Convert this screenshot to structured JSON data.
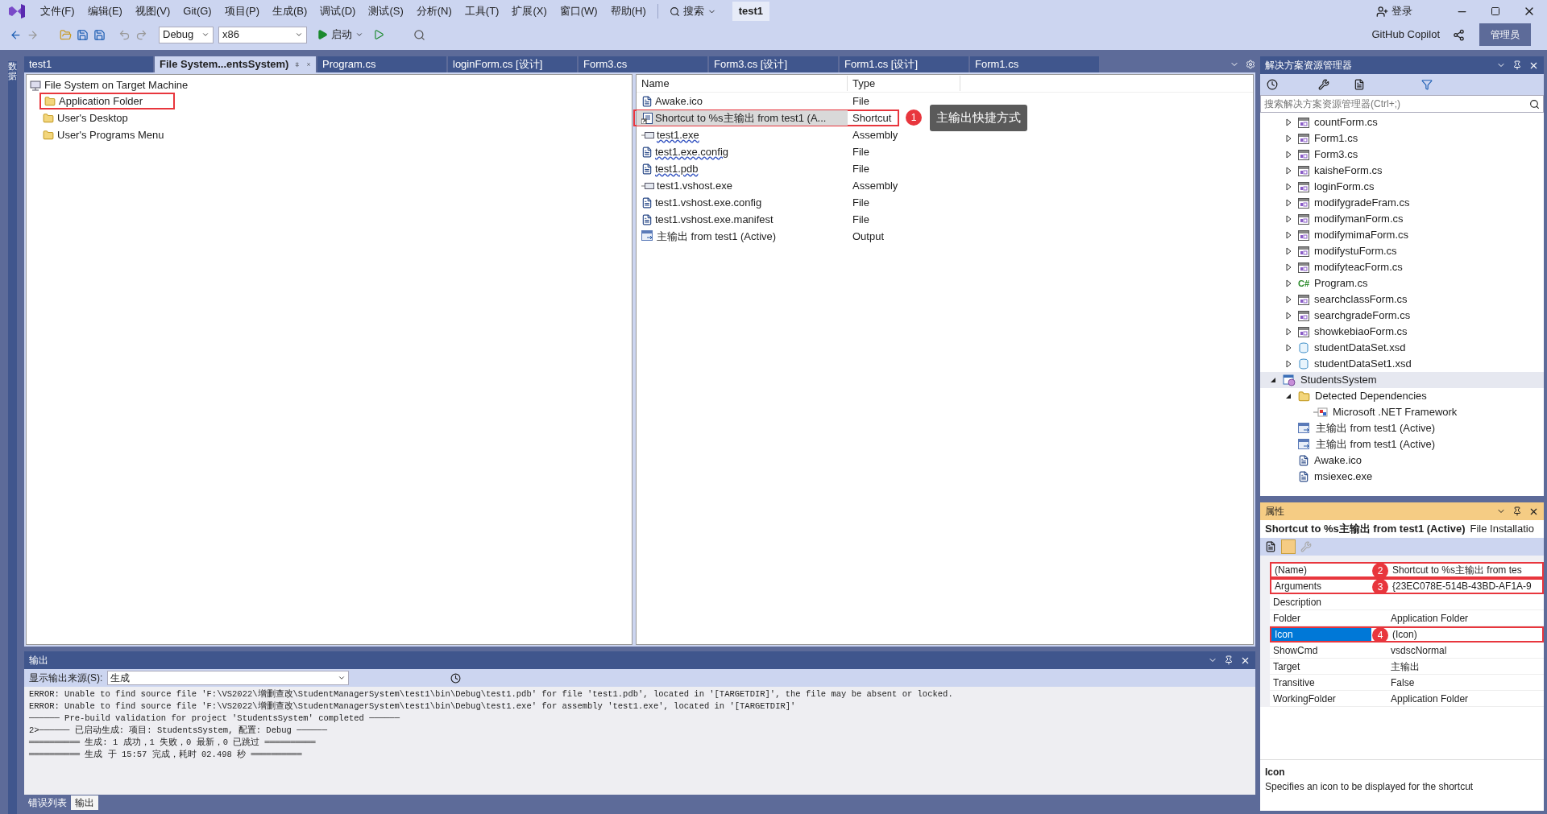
{
  "menu": [
    "文件(F)",
    "编辑(E)",
    "视图(V)",
    "Git(G)",
    "项目(P)",
    "生成(B)",
    "调试(D)",
    "测试(S)",
    "分析(N)",
    "工具(T)",
    "扩展(X)",
    "窗口(W)",
    "帮助(H)"
  ],
  "search": "搜索",
  "solution_title": "test1",
  "login": "登录",
  "toolbar": {
    "configuration": "Debug",
    "platform": "x86",
    "start": "启动"
  },
  "copilot": "GitHub Copilot",
  "admin": "管理员",
  "side_strip": "数据",
  "doc_tabs": [
    {
      "label": "test1",
      "selected": false
    },
    {
      "label": "File System...entsSystem)",
      "selected": true
    },
    {
      "label": "Program.cs",
      "selected": false
    },
    {
      "label": "loginForm.cs [设计]",
      "selected": false
    },
    {
      "label": "Form3.cs",
      "selected": false
    },
    {
      "label": "Form3.cs [设计]",
      "selected": false
    },
    {
      "label": "Form1.cs [设计]",
      "selected": false
    },
    {
      "label": "Form1.cs",
      "selected": false
    }
  ],
  "fs_tree": {
    "label": "File System on Target Machine",
    "children": [
      {
        "label": "Application Folder",
        "outlined": true
      },
      {
        "label": "User's Desktop",
        "outlined": false
      },
      {
        "label": "User's Programs Menu",
        "outlined": false
      }
    ]
  },
  "file_list": {
    "columns": [
      "Name",
      "Type"
    ],
    "rows": [
      {
        "kind": "file",
        "name": "Awake.ico",
        "type": "File",
        "selected": false,
        "squiggle": false
      },
      {
        "kind": "shortcut",
        "name": "Shortcut to %s主输出 from test1 (A...",
        "type": "Shortcut",
        "selected": true,
        "squiggle": false,
        "marker": "1",
        "callout": "主输出快捷方式"
      },
      {
        "kind": "assembly",
        "name": "test1.exe",
        "type": "Assembly",
        "selected": false,
        "squiggle": true
      },
      {
        "kind": "file",
        "name": "test1.exe.config",
        "type": "File",
        "selected": false,
        "squiggle": true
      },
      {
        "kind": "file",
        "name": "test1.pdb",
        "type": "File",
        "selected": false,
        "squiggle": true
      },
      {
        "kind": "assembly",
        "name": "test1.vshost.exe",
        "type": "Assembly",
        "selected": false,
        "squiggle": false
      },
      {
        "kind": "file",
        "name": "test1.vshost.exe.config",
        "type": "File",
        "selected": false,
        "squiggle": false
      },
      {
        "kind": "file",
        "name": "test1.vshost.exe.manifest",
        "type": "File",
        "selected": false,
        "squiggle": false
      },
      {
        "kind": "output",
        "name": "主输出 from test1 (Active)",
        "type": "Output",
        "selected": false,
        "squiggle": false
      }
    ]
  },
  "solution_explorer": {
    "title": "解决方案资源管理器",
    "search_placeholder": "搜索解决方案资源管理器(Ctrl+;)",
    "scrolled_items": [
      {
        "kind": "form",
        "label": "countForm.cs",
        "expanded": false
      },
      {
        "kind": "form",
        "label": "Form1.cs",
        "expanded": false
      },
      {
        "kind": "form",
        "label": "Form3.cs",
        "expanded": false
      },
      {
        "kind": "form",
        "label": "kaisheForm.cs",
        "expanded": false
      },
      {
        "kind": "form",
        "label": "loginForm.cs",
        "expanded": false
      },
      {
        "kind": "form",
        "label": "modifygradeFram.cs",
        "expanded": false
      },
      {
        "kind": "form",
        "label": "modifymanForm.cs",
        "expanded": false
      },
      {
        "kind": "form",
        "label": "modifymimaForm.cs",
        "expanded": false
      },
      {
        "kind": "form",
        "label": "modifystuForm.cs",
        "expanded": false
      },
      {
        "kind": "form",
        "label": "modifyteacForm.cs",
        "expanded": false
      },
      {
        "kind": "csharp",
        "label": "Program.cs",
        "expanded": false,
        "badge": "C#"
      },
      {
        "kind": "form",
        "label": "searchclassForm.cs",
        "expanded": false
      },
      {
        "kind": "form",
        "label": "searchgradeForm.cs",
        "expanded": false
      },
      {
        "kind": "form",
        "label": "showkebiaoForm.cs",
        "expanded": false
      },
      {
        "kind": "dataset",
        "label": "studentDataSet.xsd",
        "expanded": false
      },
      {
        "kind": "dataset",
        "label": "studentDataSet1.xsd",
        "expanded": false
      }
    ],
    "project": {
      "kind": "project",
      "label": "StudentsSystem",
      "expanded": true,
      "selected": true,
      "children": [
        {
          "kind": "folder",
          "label": "Detected Dependencies",
          "expanded": true,
          "children": [
            {
              "kind": "reference",
              "label": "Microsoft .NET Framework"
            }
          ]
        },
        {
          "kind": "output",
          "label": "主输出 from test1 (Active)"
        },
        {
          "kind": "output",
          "label": "主输出 from test1 (Active)"
        },
        {
          "kind": "file",
          "label": "Awake.ico"
        },
        {
          "kind": "file",
          "label": "msiexec.exe"
        }
      ]
    }
  },
  "properties": {
    "title": "属性",
    "object": "Shortcut to %s主输出 from test1 (Active)",
    "object_type": "File Installatio",
    "rows": [
      {
        "name": "(Name)",
        "value": "Shortcut to %s主输出 from tes",
        "selected": false,
        "marker": "2"
      },
      {
        "name": "Arguments",
        "value": "{23EC078E-514B-43BD-AF1A-9",
        "selected": false,
        "marker": "3"
      },
      {
        "name": "Description",
        "selected": false
      },
      {
        "name": "Folder",
        "value": "Application Folder",
        "selected": false
      },
      {
        "name": "Icon",
        "value": "(Icon)",
        "selected": true,
        "marker": "4"
      },
      {
        "name": "ShowCmd",
        "value": "vsdscNormal",
        "selected": false
      },
      {
        "name": "Target",
        "value": "主输出",
        "selected": false
      },
      {
        "name": "Transitive",
        "value": "False",
        "selected": false
      },
      {
        "name": "WorkingFolder",
        "value": "Application Folder",
        "selected": false
      }
    ],
    "help_title": "Icon",
    "help_text": "Specifies an icon to be displayed for the shortcut"
  },
  "output": {
    "title": "输出",
    "source_label": "显示输出来源(S):",
    "source": "生成",
    "lines": [
      "ERROR: Unable to find source file 'F:\\VS2022\\增删查改\\StudentManagerSystem\\test1\\bin\\Debug\\test1.pdb' for file 'test1.pdb', located in '[TARGETDIR]', the file may be absent or locked.",
      "ERROR: Unable to find source file 'F:\\VS2022\\增删查改\\StudentManagerSystem\\test1\\bin\\Debug\\test1.exe' for assembly 'test1.exe', located in '[TARGETDIR]'",
      "────── Pre-build validation for project 'StudentsSystem' completed ──────",
      "2>────── 已启动生成: 项目: StudentsSystem, 配置: Debug ──────",
      "══════════ 生成: 1 成功，1 失败，0 最新，0 已跳过 ══════════",
      "══════════ 生成 于 15:57 完成，耗时 02.498 秒 ══════════"
    ]
  },
  "bottom_tabs": [
    {
      "label": "错误列表",
      "selected": false
    },
    {
      "label": "输出",
      "selected": true
    }
  ]
}
